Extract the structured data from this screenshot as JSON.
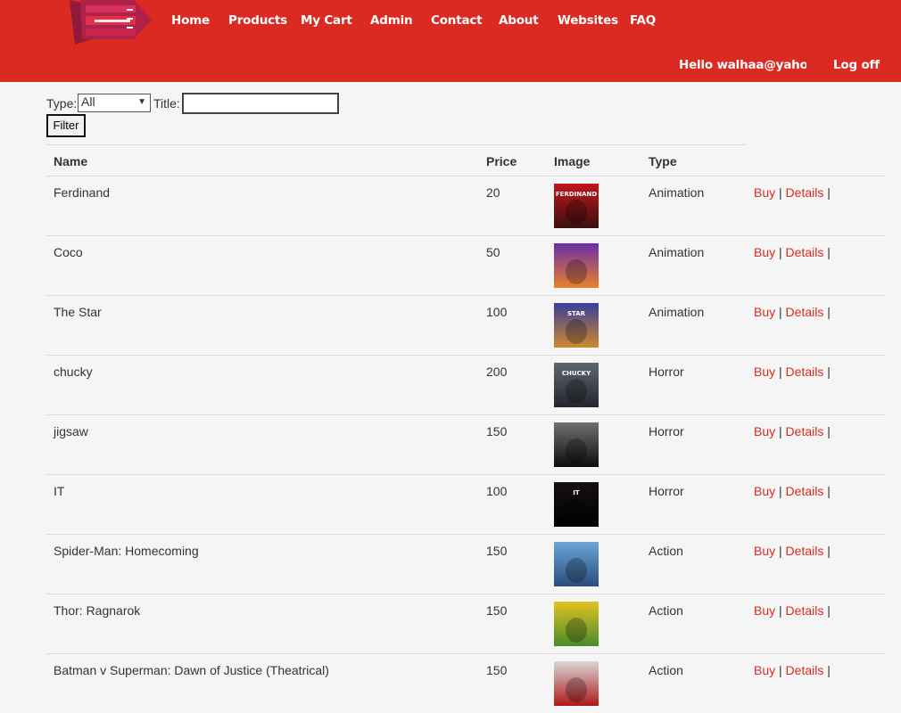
{
  "nav": {
    "items": [
      "Home",
      "Products",
      "My Cart",
      "Admin",
      "Contact",
      "About",
      "Websites",
      "FAQ"
    ]
  },
  "user": {
    "greeting": "Hello walhaa@yahoo.co",
    "logoff": "Log off"
  },
  "filters": {
    "type_label": "Type:",
    "type_value": "All",
    "title_label": "Title:",
    "title_value": "",
    "filter_button": "Filter"
  },
  "table": {
    "headers": {
      "name": "Name",
      "price": "Price",
      "image": "Image",
      "type": "Type"
    },
    "buy_label": "Buy",
    "details_label": "Details",
    "rows": [
      {
        "name": "Ferdinand",
        "price": "20",
        "type": "Animation",
        "poster_title": "FERDINAND",
        "colors": [
          "#c2161a",
          "#3a1010"
        ]
      },
      {
        "name": "Coco",
        "price": "50",
        "type": "Animation",
        "poster_title": "",
        "colors": [
          "#6a2ca8",
          "#e8822a"
        ]
      },
      {
        "name": "The Star",
        "price": "100",
        "type": "Animation",
        "poster_title": "STAR",
        "colors": [
          "#3a3c9e",
          "#d08a2e"
        ]
      },
      {
        "name": "chucky",
        "price": "200",
        "type": "Horror",
        "poster_title": "CHUCKY",
        "colors": [
          "#5d6670",
          "#23272c"
        ]
      },
      {
        "name": "jigsaw",
        "price": "150",
        "type": "Horror",
        "poster_title": "",
        "colors": [
          "#707070",
          "#0d0d0d"
        ]
      },
      {
        "name": "IT",
        "price": "100",
        "type": "Horror",
        "poster_title": "IT",
        "colors": [
          "#151010",
          "#000000"
        ]
      },
      {
        "name": "Spider-Man: Homecoming",
        "price": "150",
        "type": "Action",
        "poster_title": "",
        "colors": [
          "#6aa6d8",
          "#2a4d7a"
        ]
      },
      {
        "name": "Thor: Ragnarok",
        "price": "150",
        "type": "Action",
        "poster_title": "",
        "colors": [
          "#e2c321",
          "#4a8a2a"
        ]
      },
      {
        "name": "Batman v Superman: Dawn of Justice (Theatrical)",
        "price": "150",
        "type": "Action",
        "poster_title": "",
        "colors": [
          "#d8d8d8",
          "#b01818"
        ]
      }
    ]
  },
  "colors": {
    "brand": "#da2a21",
    "link": "#da2a21"
  }
}
